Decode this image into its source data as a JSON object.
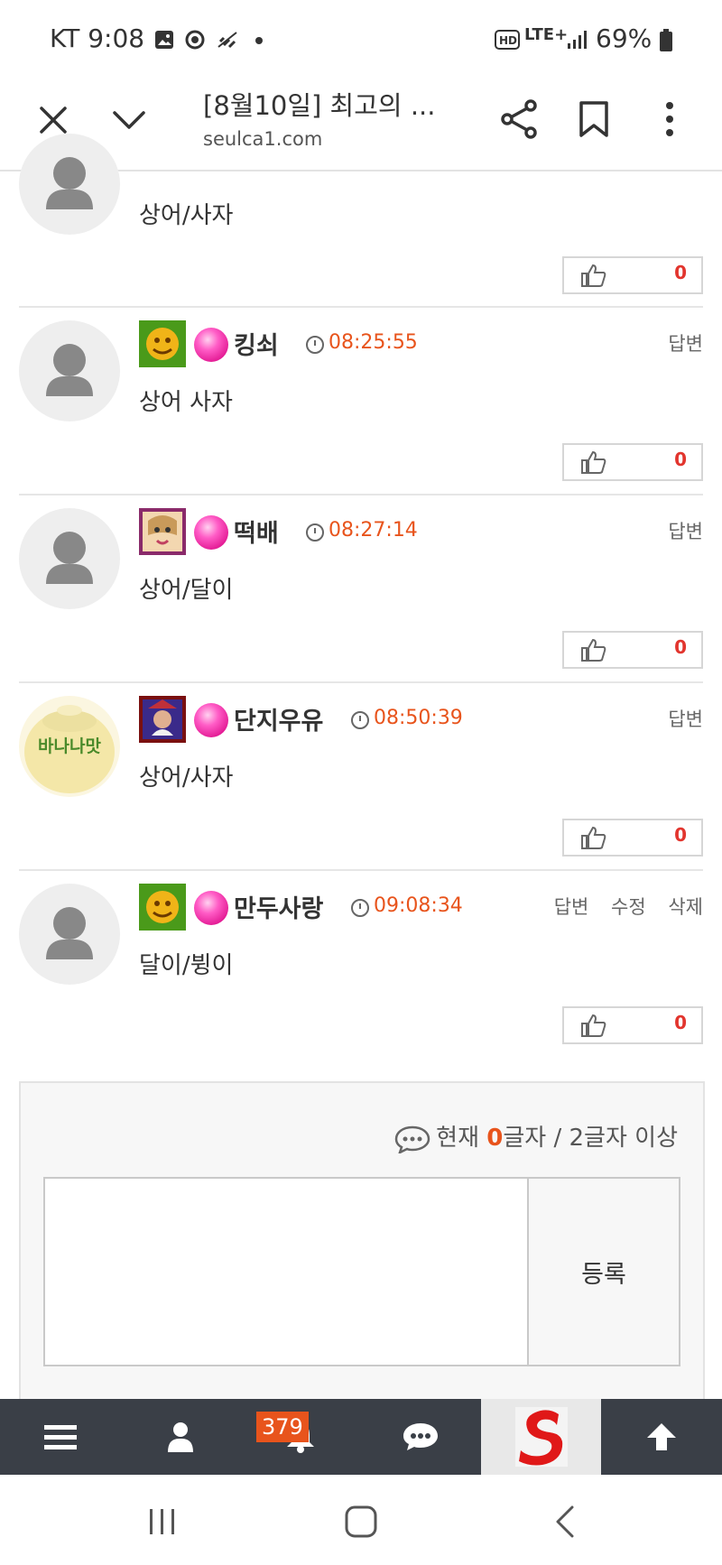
{
  "status_bar": {
    "time": "KT 9:08",
    "battery": "69%",
    "network": "LTE+"
  },
  "browser": {
    "title": "[8월10일] 최고의 ...",
    "url": "seulca1.com"
  },
  "comments": [
    {
      "content": "상어/사자",
      "likes": "0"
    },
    {
      "nickname": "킹쇠",
      "time": "08:25:55",
      "content": "상어 사자",
      "likes": "0",
      "actions": [
        "답변"
      ]
    },
    {
      "nickname": "떡배",
      "time": "08:27:14",
      "content": "상어/달이",
      "likes": "0",
      "actions": [
        "답변"
      ]
    },
    {
      "nickname": "단지우유",
      "time": "08:50:39",
      "content": "상어/사자",
      "likes": "0",
      "actions": [
        "답변"
      ],
      "avatar_text": "바나나맛"
    },
    {
      "nickname": "만두사랑",
      "time": "09:08:34",
      "content": "달이/뷩이",
      "likes": "0",
      "actions": [
        "답변",
        "수정",
        "삭제"
      ]
    }
  ],
  "comment_form": {
    "counter_prefix": "현재 ",
    "counter_value": "0",
    "counter_suffix": "글자 / 2글자 이상",
    "submit_label": "등록"
  },
  "app_bar": {
    "notification_count": "379"
  }
}
